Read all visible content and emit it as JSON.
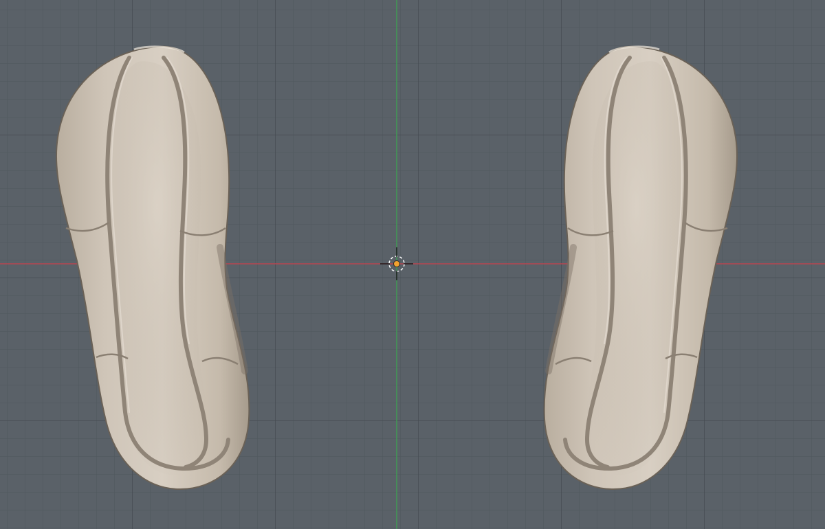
{
  "viewport": {
    "view": "top-orthographic",
    "grid_visible": true,
    "axes": {
      "x_axis_color": "#c2444e",
      "y_axis_color": "#3f9a54"
    },
    "colors": {
      "background": "#5a6168",
      "grid_minor": "#4f565d",
      "grid_major": "#474d53",
      "sole_base": "#c9bfb1",
      "sole_highlight": "#d9d0c4",
      "sole_shadow": "#8c8174",
      "origin_marker": "#f2a230",
      "cursor": "#1b1b1b"
    }
  },
  "objects": [
    {
      "name": "shoe-sole-left",
      "icon": "mesh-object"
    },
    {
      "name": "shoe-sole-right",
      "icon": "mesh-object"
    }
  ],
  "icons": {
    "origin": "origin-dot-icon",
    "cursor": "3d-cursor-icon"
  }
}
